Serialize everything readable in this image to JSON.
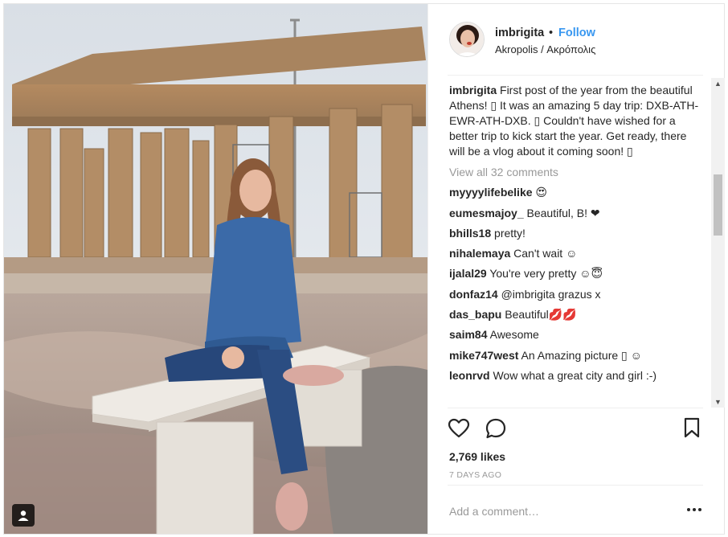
{
  "header": {
    "username": "imbrigita",
    "dot": "•",
    "follow_label": "Follow",
    "location": "Akropolis / Ακρόπολις"
  },
  "caption": {
    "username": "imbrigita",
    "text": "First post of the year from the beautiful Athens! ▯ It was an amazing 5 day trip: DXB-ATH-EWR-ATH-DXB. ▯ Couldn't have wished for a better trip to kick start the year. Get ready, there will be a vlog about it coming soon! ▯"
  },
  "view_all_label": "View all 32 comments",
  "comments": [
    {
      "user": "myyyylifebelike",
      "text": "😍"
    },
    {
      "user": "eumesmajoy_",
      "text": "Beautiful, B! ❤"
    },
    {
      "user": "bhills18",
      "text": "pretty!"
    },
    {
      "user": "nihalemaya",
      "text": "Can't wait ☺"
    },
    {
      "user": "ijalal29",
      "text": "You're very pretty ☺😇"
    },
    {
      "user": "donfaz14",
      "text": "@imbrigita grazus x"
    },
    {
      "user": "das_bapu",
      "text": "Beautiful💋💋"
    },
    {
      "user": "saim84",
      "text": "Awesome"
    },
    {
      "user": "mike747west",
      "text": "An Amazing picture ▯ ☺"
    },
    {
      "user": "leonrvd",
      "text": "Wow what a great city and girl :-)"
    }
  ],
  "likes_label": "2,769 likes",
  "age_label": "7 DAYS AGO",
  "add_comment_placeholder": "Add a comment…",
  "icons": {
    "like": "heart-icon",
    "comment": "comment-bubble-icon",
    "save": "bookmark-icon",
    "more": "more-options-icon",
    "tag": "user-tag-icon"
  },
  "colors": {
    "follow": "#3897f0",
    "muted": "#999999",
    "text": "#262626"
  }
}
